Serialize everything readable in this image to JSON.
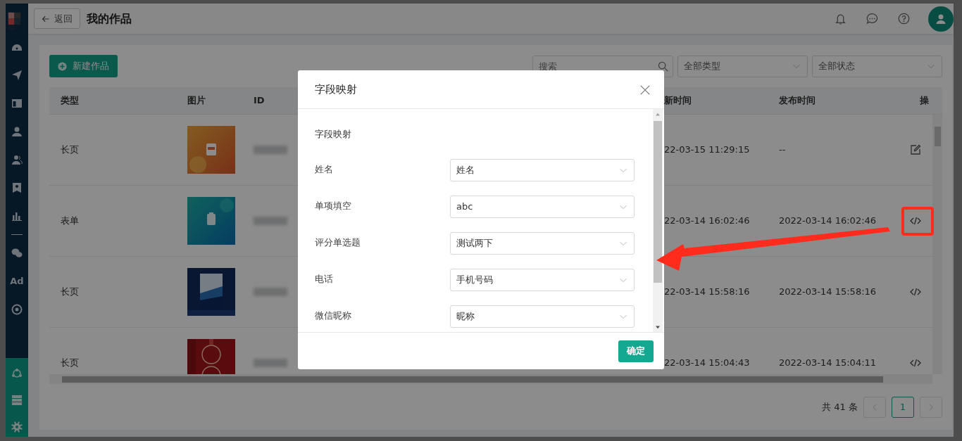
{
  "header": {
    "back_button": "返回",
    "title": "我的作品"
  },
  "sidebar": {
    "ad_label": "Ad"
  },
  "toolbar": {
    "new_button": "新建作品",
    "search": {
      "placeholder": "搜索"
    },
    "filters": [
      "全部类型",
      "全部状态"
    ]
  },
  "table": {
    "columns": [
      "类型",
      "图片",
      "ID",
      "新时间",
      "发布时间",
      "操"
    ],
    "rows": [
      {
        "type": "长页",
        "updated": "22-03-15 11:29:15",
        "published": "--",
        "action": {
          "kind": "edit"
        },
        "highlighted": false
      },
      {
        "type": "表单",
        "updated": "22-03-14 16:02:46",
        "published": "2022-03-14 16:02:46",
        "action": {
          "kind": "code"
        },
        "highlighted": true
      },
      {
        "type": "长页",
        "updated": "22-03-14 15:58:16",
        "published": "2022-03-14 15:58:16",
        "action": {
          "kind": "code"
        },
        "highlighted": false
      },
      {
        "type": "长页",
        "updated": "22-03-14 15:04:43",
        "published": "2022-03-14 15:04:11",
        "action": {
          "kind": "code"
        },
        "highlighted": false
      }
    ]
  },
  "pagination": {
    "total": "共 41 条",
    "pages": [
      {
        "label": "1",
        "selected": true
      }
    ]
  },
  "dialog": {
    "title": "字段映射",
    "section_label": "字段映射",
    "fields": [
      {
        "label": "姓名",
        "value": "姓名"
      },
      {
        "label": "单项填空",
        "value": "abc"
      },
      {
        "label": "评分单选题",
        "value": "测试两下"
      },
      {
        "label": "电话",
        "value": "手机号码"
      },
      {
        "label": "微信昵称",
        "value": "昵称"
      }
    ],
    "confirm_button": "确定"
  }
}
